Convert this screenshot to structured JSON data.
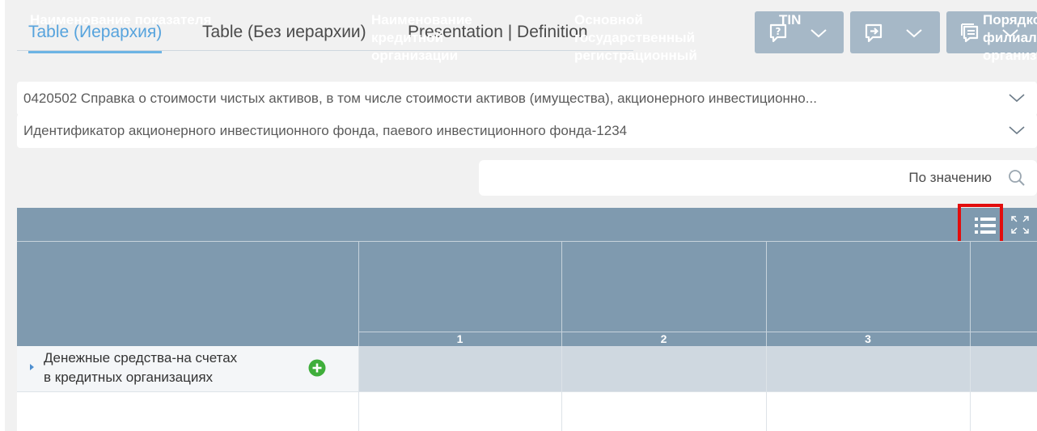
{
  "tabs": [
    {
      "label": "Table (Иерархия)",
      "active": true
    },
    {
      "label": "Table (Без иерархии)",
      "active": false
    },
    {
      "label": "Presentation | Definition",
      "active": false
    }
  ],
  "actions": [
    {
      "icon": "question-comment-icon"
    },
    {
      "icon": "comment-arrow-icon"
    },
    {
      "icon": "comments-list-icon"
    }
  ],
  "form_select": {
    "value": "0420502 Справка о стоимости чистых активов, в том числе стоимости активов (имущества), акционерного инвестиционно..."
  },
  "fund_select": {
    "value": "Идентификатор акционерного инвестиционного фонда, паевого инвестиционного фонда-1234"
  },
  "search": {
    "placeholder": "По значению"
  },
  "table": {
    "toolbar_icons": [
      "list-view-icon",
      "expand-icon"
    ],
    "columns": [
      {
        "header": "Наименование показателя",
        "num": ""
      },
      {
        "header": "Наименование кредитной организации",
        "num": "1"
      },
      {
        "header": "Основной государственный регистрационный",
        "num": "2"
      },
      {
        "header": "TIN",
        "num": "3"
      },
      {
        "header": "Порядковый филиала организации",
        "num": ""
      }
    ],
    "rows": [
      {
        "label_line1": "Денежные средства-на счетах",
        "label_line2": "в кредитных организациях"
      }
    ]
  },
  "colors": {
    "accent": "#56a3dd",
    "header_bg": "#7f9aaf",
    "action_bg": "#a6b8c7",
    "highlight": "#e20d0d",
    "add_green": "#3fae3b"
  }
}
